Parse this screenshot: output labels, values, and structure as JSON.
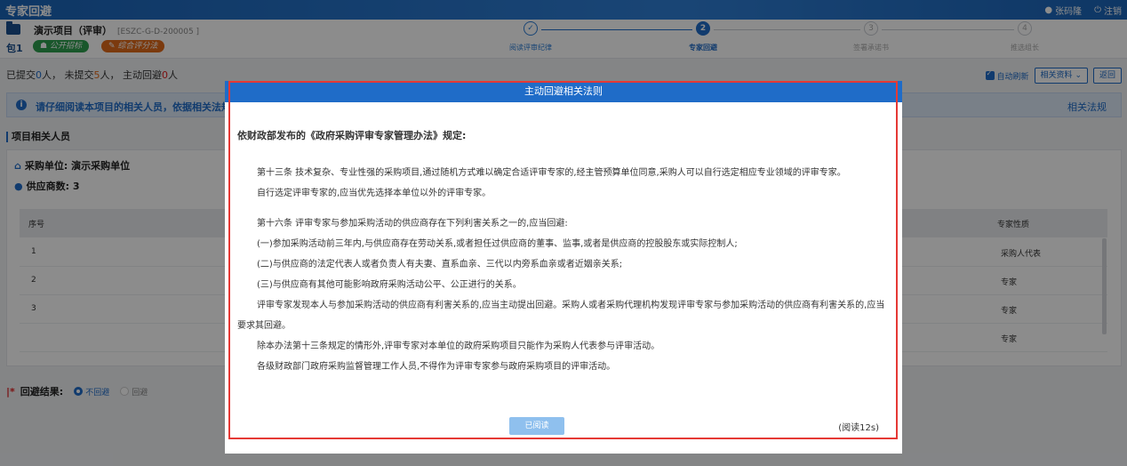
{
  "app": {
    "title": "专家回避",
    "user": "张码隆",
    "logout": "注销"
  },
  "project": {
    "name": "演示项目（评审）",
    "code": "[ESZC-G-D-200005 ]",
    "package": "包1",
    "tags": [
      "公开招标",
      "综合评分法"
    ]
  },
  "steps": [
    {
      "num": "✓",
      "label": "阅读评审纪律",
      "state": "done"
    },
    {
      "num": "2",
      "label": "专家回避",
      "state": "active"
    },
    {
      "num": "3",
      "label": "签署承诺书",
      "state": "todo"
    },
    {
      "num": "4",
      "label": "推选组长",
      "state": "todo"
    }
  ],
  "status": {
    "submitted_label": "已提交",
    "submitted": "0",
    "unit1": "人，",
    "unsubmitted_label": "未提交",
    "unsubmitted": "5",
    "unit2": "人，",
    "avoided_label": "主动回避",
    "avoided": "0",
    "unit3": "人"
  },
  "toolbar": {
    "auto_refresh": "自动刷新",
    "related_docs": "相关资料",
    "back": "返回"
  },
  "notice": {
    "text": "请仔细阅读本项目的相关人员，依据相关法规",
    "link": "相关法规"
  },
  "section": {
    "title": "项目相关人员",
    "purchaser": "采购单位: 演示采购单位",
    "suppliers": "供应商数: 3"
  },
  "table": {
    "headers": {
      "no": "序号",
      "type": "专家性质"
    },
    "rows": [
      {
        "no": "1",
        "type": "采购人代表"
      },
      {
        "no": "2",
        "type": "专家"
      },
      {
        "no": "3",
        "type": "专家"
      },
      {
        "no": "",
        "type": "专家"
      }
    ]
  },
  "result": {
    "label": "回避结果:",
    "options": [
      "不回避",
      "回避"
    ],
    "selected": "不回避"
  },
  "modal": {
    "title": "主动回避相关法则",
    "heading": "依财政部发布的《政府采购评审专家管理办法》规定:",
    "para1": [
      "第十三条 技术复杂、专业性强的采购项目,通过随机方式难以确定合适评审专家的,经主管预算单位同意,采购人可以自行选定相应专业领域的评审专家。",
      "自行选定评审专家的,应当优先选择本单位以外的评审专家。"
    ],
    "para2": [
      "第十六条 评审专家与参加采购活动的供应商存在下列利害关系之一的,应当回避:",
      "(一)参加采购活动前三年内,与供应商存在劳动关系,或者担任过供应商的董事、监事,或者是供应商的控股股东或实际控制人;",
      "(二)与供应商的法定代表人或者负责人有夫妻、直系血亲、三代以内旁系血亲或者近姻亲关系;",
      "(三)与供应商有其他可能影响政府采购活动公平、公正进行的关系。",
      "评审专家发现本人与参加采购活动的供应商有利害关系的,应当主动提出回避。采购人或者采购代理机构发现评审专家与参加采购活动的供应商有利害关系的,应当要求其回避。",
      "除本办法第十三条规定的情形外,评审专家对本单位的政府采购项目只能作为采购人代表参与评审活动。",
      "各级财政部门政府采购监督管理工作人员,不得作为评审专家参与政府采购项目的评审活动。"
    ],
    "read_button": "已阅读",
    "read_count": "(阅读12s)"
  }
}
